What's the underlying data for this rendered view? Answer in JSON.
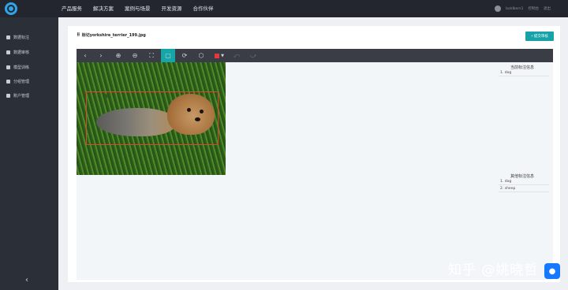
{
  "topnav": {
    "items": [
      "产品服务",
      "解决方案",
      "案例与场景",
      "开发资源",
      "合作伙伴"
    ],
    "user_name": "boldbers1",
    "user_links": [
      "控制台",
      "退出"
    ]
  },
  "sidebar": {
    "items": [
      {
        "label": "数据标注",
        "icon": "tag-icon"
      },
      {
        "label": "数据审核",
        "icon": "eye-icon"
      },
      {
        "label": "模型训练",
        "icon": "model-icon"
      },
      {
        "label": "分组管理",
        "icon": "group-icon"
      },
      {
        "label": "账户管理",
        "icon": "user-icon"
      }
    ],
    "collapse_label": "‹"
  },
  "main": {
    "title_icon": "⠿",
    "title": "标记yorkshire_terrier_199.jpg",
    "submit_label": "+ 提交审核"
  },
  "toolbar": {
    "tools": [
      "prev",
      "next",
      "zoom-in",
      "zoom-out",
      "fit",
      "rect",
      "rotate",
      "polygon",
      "color",
      "undo",
      "redo"
    ],
    "active_color": "#e4393c",
    "accent": "#16a6a8"
  },
  "current_labels": {
    "title": "当前标注信息",
    "items": [
      "1. dog"
    ]
  },
  "other_labels": {
    "title": "其他标注信息",
    "items": [
      "1. dog",
      "2. sheep"
    ]
  },
  "watermark": "知乎 @姚晓哲"
}
